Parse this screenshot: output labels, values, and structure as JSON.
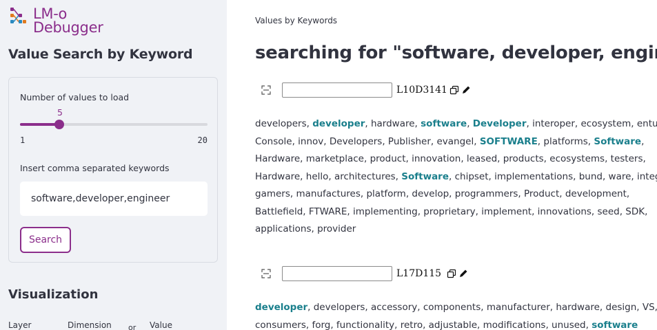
{
  "app": {
    "logo_line1": "LM-ο",
    "logo_line2": "Debugger",
    "logo_icon": "network-graph-icon"
  },
  "sidebar": {
    "title": "Value Search by Keyword",
    "slider": {
      "label": "Number of values to load",
      "value": "5",
      "min": "1",
      "max": "20",
      "fraction": 0.2105
    },
    "keywords": {
      "label": "Insert comma separated keywords",
      "value": "software,developer,engineer"
    },
    "search_label": "Search",
    "visualization": {
      "title": "Visualization",
      "columns": [
        "Layer",
        "Dimension",
        "or",
        "Value"
      ]
    }
  },
  "main": {
    "breadcrumb": "Values by Keywords",
    "heading": "searching for \"software, developer, engineer\"",
    "highlight_color": "#1a7f8c",
    "accent_color": "#8b2e8b",
    "results": [
      {
        "id": "L10D3141",
        "lines": [
          [
            [
              "developers, ",
              false
            ],
            [
              "developer",
              true
            ],
            [
              ", hardware, ",
              false
            ],
            [
              "software",
              true
            ],
            [
              ", ",
              false
            ],
            [
              "Developer",
              true
            ],
            [
              ", interoper, ecosystem, enture,",
              false
            ]
          ],
          [
            [
              "Console, innov, Developers, Publisher, evangel, ",
              false
            ],
            [
              "SOFTWARE",
              true
            ],
            [
              ", platforms, ",
              false
            ],
            [
              "Software",
              true
            ],
            [
              ",",
              false
            ]
          ],
          [
            [
              "Hardware, marketplace, product, innovation, leased, products, ecosystems, testers,",
              false
            ]
          ],
          [
            [
              "Hardware, hello, architectures, ",
              false
            ],
            [
              "Software",
              true
            ],
            [
              ", chipset, implementations, bund, ware, integ",
              false
            ]
          ],
          [
            [
              "gamers, manufactures, platform, develop, programmers, Product, development,",
              false
            ]
          ],
          [
            [
              "Battlefield, FTWARE, implementing, proprietary, implement, innovations, seed, SDK,",
              false
            ]
          ],
          [
            [
              "applications, provider",
              false
            ]
          ]
        ]
      },
      {
        "id": "L17D115 ",
        "lines": [
          [
            [
              "developer",
              true
            ],
            [
              ", developers, accessory, components, manufacturer, hardware, design, VS,",
              false
            ]
          ],
          [
            [
              "consumers, forg, functionality, retro, adjustable, modifications, unused, ",
              false
            ],
            [
              "software",
              true
            ]
          ]
        ]
      }
    ]
  }
}
